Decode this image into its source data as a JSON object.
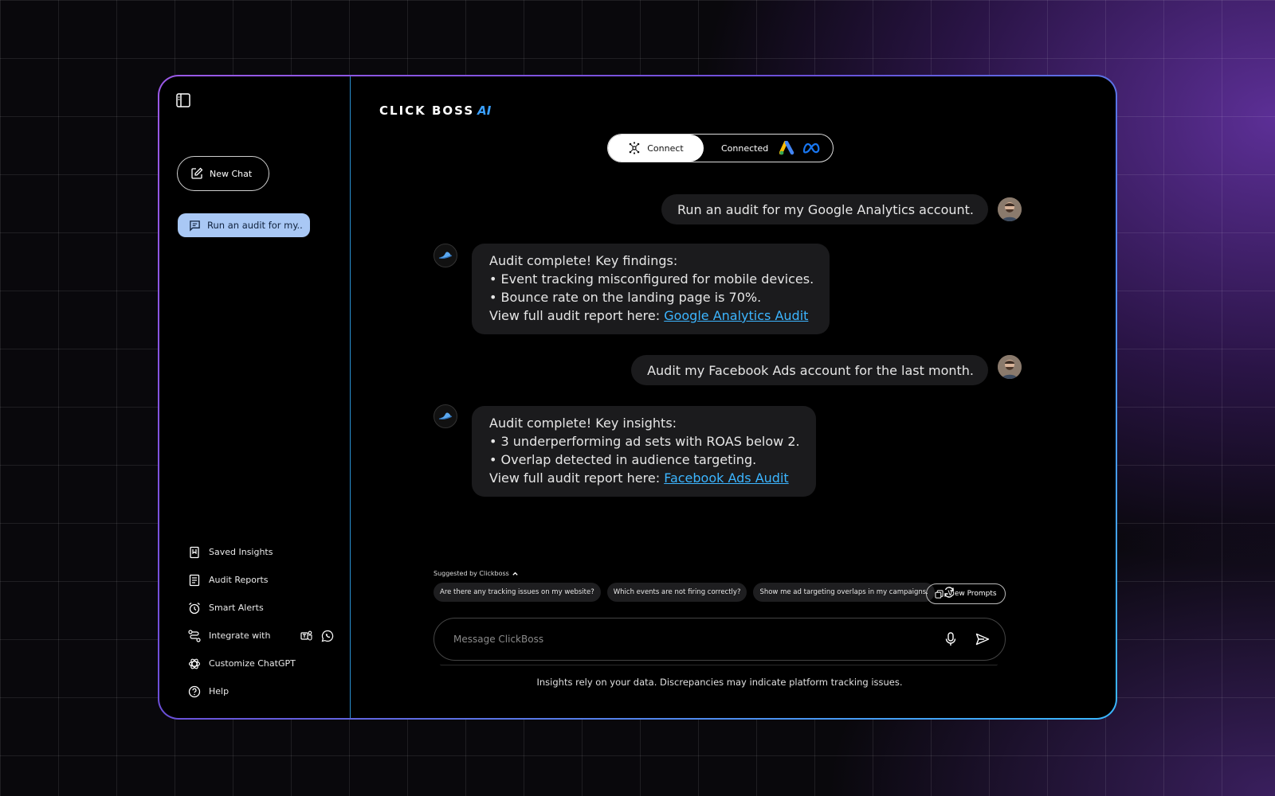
{
  "sidebar": {
    "new_chat_label": "New Chat",
    "history": [
      {
        "label": "Run an audit for my.."
      }
    ],
    "menu": [
      {
        "label": "Saved Insights",
        "icon": "bookmark-icon"
      },
      {
        "label": "Audit Reports",
        "icon": "report-icon"
      },
      {
        "label": "Smart Alerts",
        "icon": "alarm-icon"
      },
      {
        "label": "Integrate with",
        "icon": "route-icon"
      },
      {
        "label": "Customize ChatGPT",
        "icon": "openai-icon"
      },
      {
        "label": "Help",
        "icon": "help-icon"
      }
    ]
  },
  "header": {
    "logo_text": "CLICK BOSS",
    "logo_ai": "AI",
    "connect_label": "Connect",
    "connected_label": "Connected"
  },
  "messages": [
    {
      "role": "user",
      "text": "Run an audit for my Google Analytics account."
    },
    {
      "role": "bot",
      "lines": [
        "Audit complete! Key findings:",
        "• Event tracking misconfigured for mobile devices.",
        "• Bounce rate on the landing page is 70%."
      ],
      "link_prefix": "View full audit report here: ",
      "link_text": "Google Analytics Audit"
    },
    {
      "role": "user",
      "text": "Audit my Facebook Ads account for the last month."
    },
    {
      "role": "bot",
      "lines": [
        "Audit complete! Key insights:",
        "• 3 underperforming ad sets with ROAS below 2.",
        "• Overlap detected in audience targeting."
      ],
      "link_prefix": "View full audit report here: ",
      "link_text": "Facebook Ads Audit"
    }
  ],
  "suggestions": {
    "header": "Suggested by Clickboss",
    "chips": [
      "Are there any tracking issues on my website?",
      "Which events are not firing correctly?",
      "Show me ad targeting overlaps in my campaigns."
    ],
    "view_prompts_label": "View Prompts"
  },
  "composer": {
    "placeholder": "Message ClickBoss"
  },
  "disclaimer": "Insights rely on your data. Discrepancies may indicate platform tracking issues.",
  "colors": {
    "accent": "#3cb5ff",
    "history_bg": "#a9c8f5",
    "bubble_bg": "#1b1b1d"
  }
}
